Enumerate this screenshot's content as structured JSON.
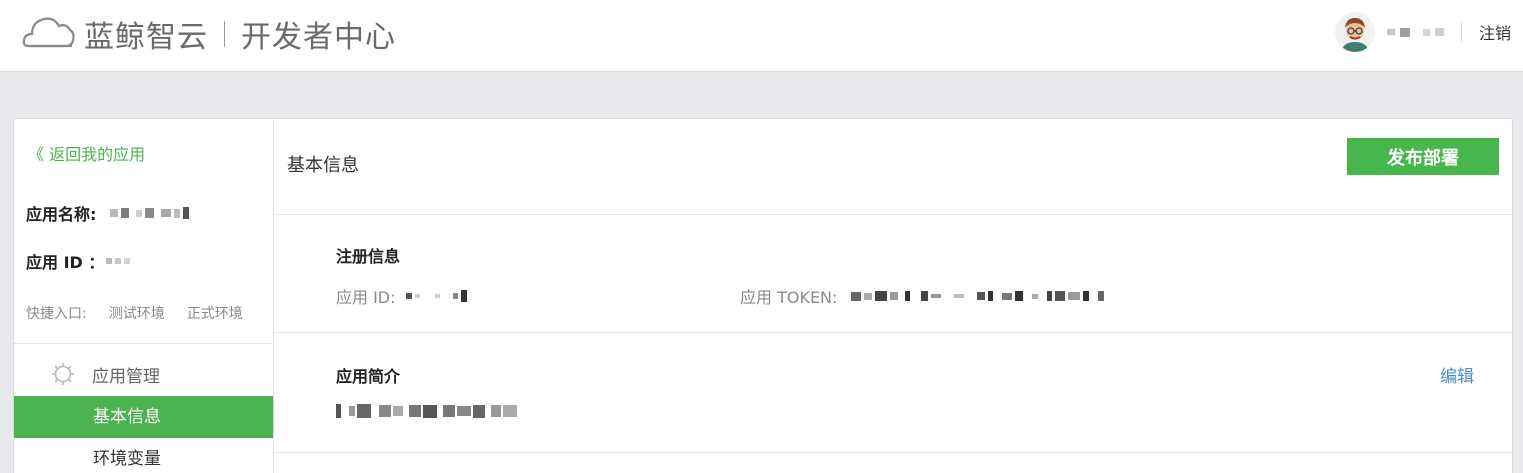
{
  "header": {
    "brand": "蓝鲸智云",
    "subtitle": "开发者中心",
    "logout_label": "注销"
  },
  "sidebar": {
    "back_label": "《 返回我的应用",
    "app_name_label": "应用名称:",
    "app_id_label": "应用 ID ：",
    "quick_label": "快捷入口:",
    "quick_links": [
      "测试环境",
      "正式环境"
    ],
    "menu_group_label": "应用管理",
    "menu_items": [
      {
        "label": "基本信息",
        "active": true
      },
      {
        "label": "环境变量",
        "active": false
      }
    ]
  },
  "content": {
    "title": "基本信息",
    "publish_label": "发布部署",
    "register_section": {
      "title": "注册信息",
      "app_id_label": "应用 ID:",
      "token_label": "应用 TOKEN:"
    },
    "intro_section": {
      "title": "应用简介",
      "edit_label": "编辑"
    }
  },
  "colors": {
    "accent_green": "#4bb450",
    "link_blue": "#4a90d0",
    "background": "#e8e9ec"
  },
  "icons": [
    "cloud-logo-icon",
    "avatar",
    "gear-icon"
  ]
}
